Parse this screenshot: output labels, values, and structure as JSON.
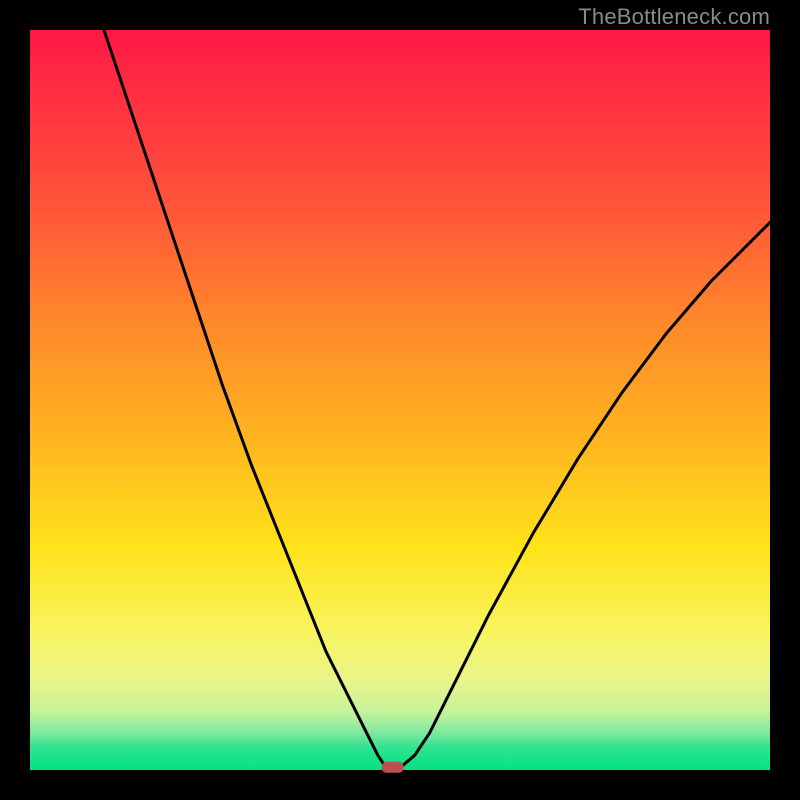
{
  "watermark": "TheBottleneck.com",
  "chart_data": {
    "type": "line",
    "title": "",
    "xlabel": "",
    "ylabel": "",
    "xlim": [
      0,
      100
    ],
    "ylim": [
      0,
      100
    ],
    "series": [
      {
        "name": "curve",
        "x": [
          10,
          14,
          18,
          22,
          26,
          30,
          34,
          38,
          40,
          42,
          44,
          46,
          47,
          48,
          49,
          50,
          52,
          54,
          58,
          62,
          68,
          74,
          80,
          86,
          92,
          100
        ],
        "y": [
          100,
          88,
          76,
          64,
          52,
          41,
          31,
          21,
          16,
          12,
          8,
          4,
          2,
          0.5,
          0.3,
          0.3,
          2,
          5,
          13,
          21,
          32,
          42,
          51,
          59,
          66,
          74
        ]
      }
    ],
    "min_marker": {
      "x": 49,
      "y": 0.3
    },
    "gradient_stops": [
      {
        "pos": 0,
        "color": "#ff1744"
      },
      {
        "pos": 25,
        "color": "#ff5838"
      },
      {
        "pos": 55,
        "color": "#ffb41f"
      },
      {
        "pos": 82,
        "color": "#f8f564"
      },
      {
        "pos": 100,
        "color": "#0be084"
      }
    ]
  }
}
